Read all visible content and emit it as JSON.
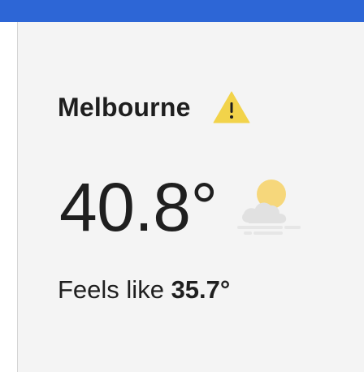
{
  "header_bar": {
    "color": "#2d66d6"
  },
  "card": {
    "city": "Melbourne",
    "warning_icon": "warning-triangle-icon",
    "temperature": "40.8°",
    "weather_icon": "sun-behind-cloud-fog-icon",
    "feels_like_label": "Feels like",
    "feels_like_value": "35.7°"
  }
}
